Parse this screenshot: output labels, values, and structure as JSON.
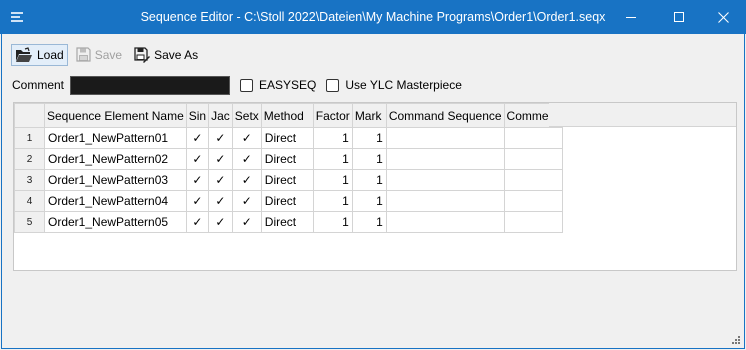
{
  "window": {
    "title": "Sequence Editor - C:\\Stoll 2022\\Dateien\\My Machine Programs\\Order1\\Order1.seqx"
  },
  "toolbar": {
    "load_label": "Load",
    "save_label": "Save",
    "save_as_label": "Save As"
  },
  "form": {
    "comment_label": "Comment",
    "comment_value": "",
    "easyseq_label": "EASYSEQ",
    "easyseq_checked": false,
    "ylc_label": "Use YLC Masterpiece",
    "ylc_checked": false
  },
  "grid": {
    "columns": [
      "Sequence Element Name",
      "Sin",
      "Jac",
      "Setx",
      "Method",
      "Factor",
      "Mark",
      "Command Sequence",
      "Comment"
    ],
    "rows": [
      {
        "num": "1",
        "name": "Order1_NewPattern01",
        "sin": "✓",
        "jac": "✓",
        "setx": "✓",
        "method": "Direct",
        "factor": "1",
        "mark": "1",
        "command": "",
        "comment": ""
      },
      {
        "num": "2",
        "name": "Order1_NewPattern02",
        "sin": "✓",
        "jac": "✓",
        "setx": "✓",
        "method": "Direct",
        "factor": "1",
        "mark": "1",
        "command": "",
        "comment": ""
      },
      {
        "num": "3",
        "name": "Order1_NewPattern03",
        "sin": "✓",
        "jac": "✓",
        "setx": "✓",
        "method": "Direct",
        "factor": "1",
        "mark": "1",
        "command": "",
        "comment": ""
      },
      {
        "num": "4",
        "name": "Order1_NewPattern04",
        "sin": "✓",
        "jac": "✓",
        "setx": "✓",
        "method": "Direct",
        "factor": "1",
        "mark": "1",
        "command": "",
        "comment": ""
      },
      {
        "num": "5",
        "name": "Order1_NewPattern05",
        "sin": "✓",
        "jac": "✓",
        "setx": "✓",
        "method": "Direct",
        "factor": "1",
        "mark": "1",
        "command": "",
        "comment": ""
      }
    ]
  },
  "colors": {
    "titlebar": "#1873c4",
    "window_bg": "#f0f0f0",
    "grid_line": "#d4d4d4"
  },
  "icons": {
    "app": "app-icon",
    "load": "folder-open-icon",
    "save": "floppy-disk-icon",
    "save_as": "save-as-icon"
  }
}
